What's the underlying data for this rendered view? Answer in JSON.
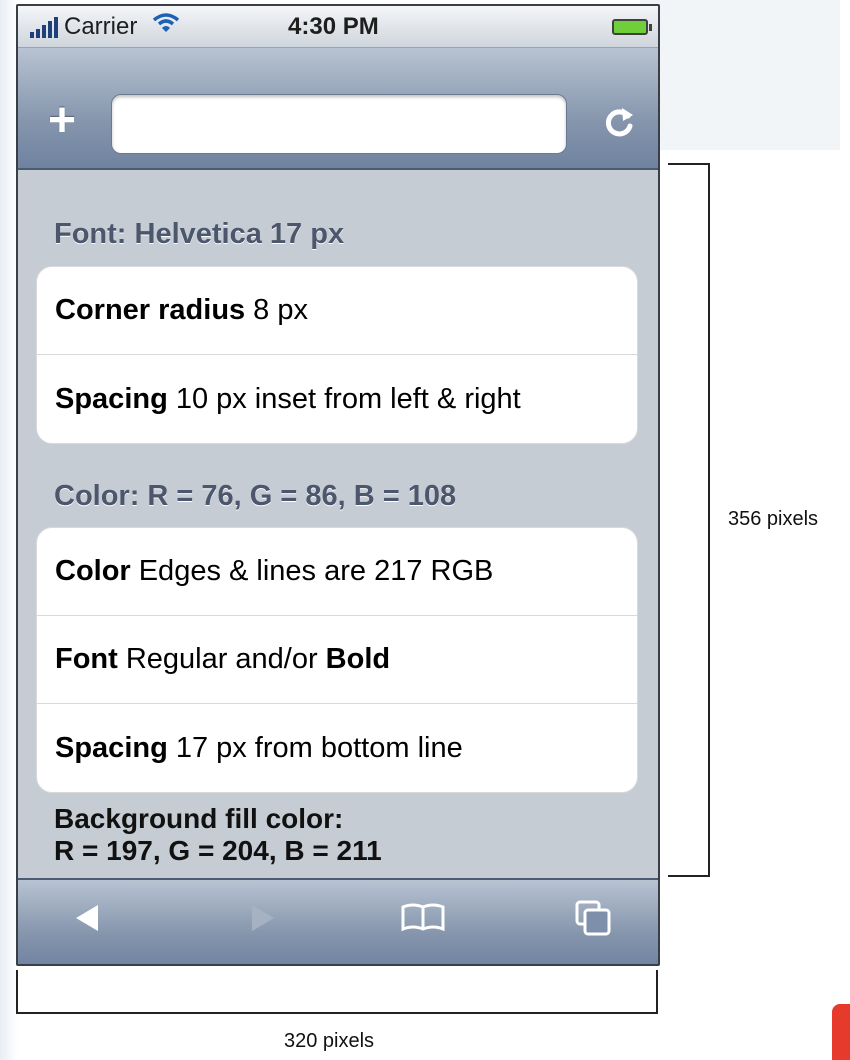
{
  "status_bar": {
    "carrier": "Carrier",
    "time": "4:30 PM"
  },
  "nav_bar": {
    "add_icon": "+",
    "address_value": "",
    "reload_icon": "↻"
  },
  "content": {
    "section1_title": "Font: Helvetica 17 px",
    "group1": [
      {
        "bold": "Corner radius",
        "text": "8 px"
      },
      {
        "bold": "Spacing",
        "text": "10 px inset from left & right"
      }
    ],
    "section2_title": "Color: R = 76, G = 86, B = 108",
    "group2_row1": {
      "bold": "Color",
      "text": "Edges & lines are 217 RGB"
    },
    "group2_row2": {
      "bold": "Font",
      "text": "Regular and/or",
      "bold_end": "Bold"
    },
    "group2_row3": {
      "bold": "Spacing",
      "text": "17 px from bottom line"
    },
    "bg_note_line1": "Background fill color:",
    "bg_note_line2": "R = 197, G = 204, B = 211"
  },
  "toolbar": {
    "back_icon": "◀",
    "forward_icon": "▶",
    "bookmarks_icon": "⎘",
    "pages_icon": "⧉"
  },
  "annotations": {
    "height_label": "356 pixels",
    "width_label": "320 pixels"
  }
}
